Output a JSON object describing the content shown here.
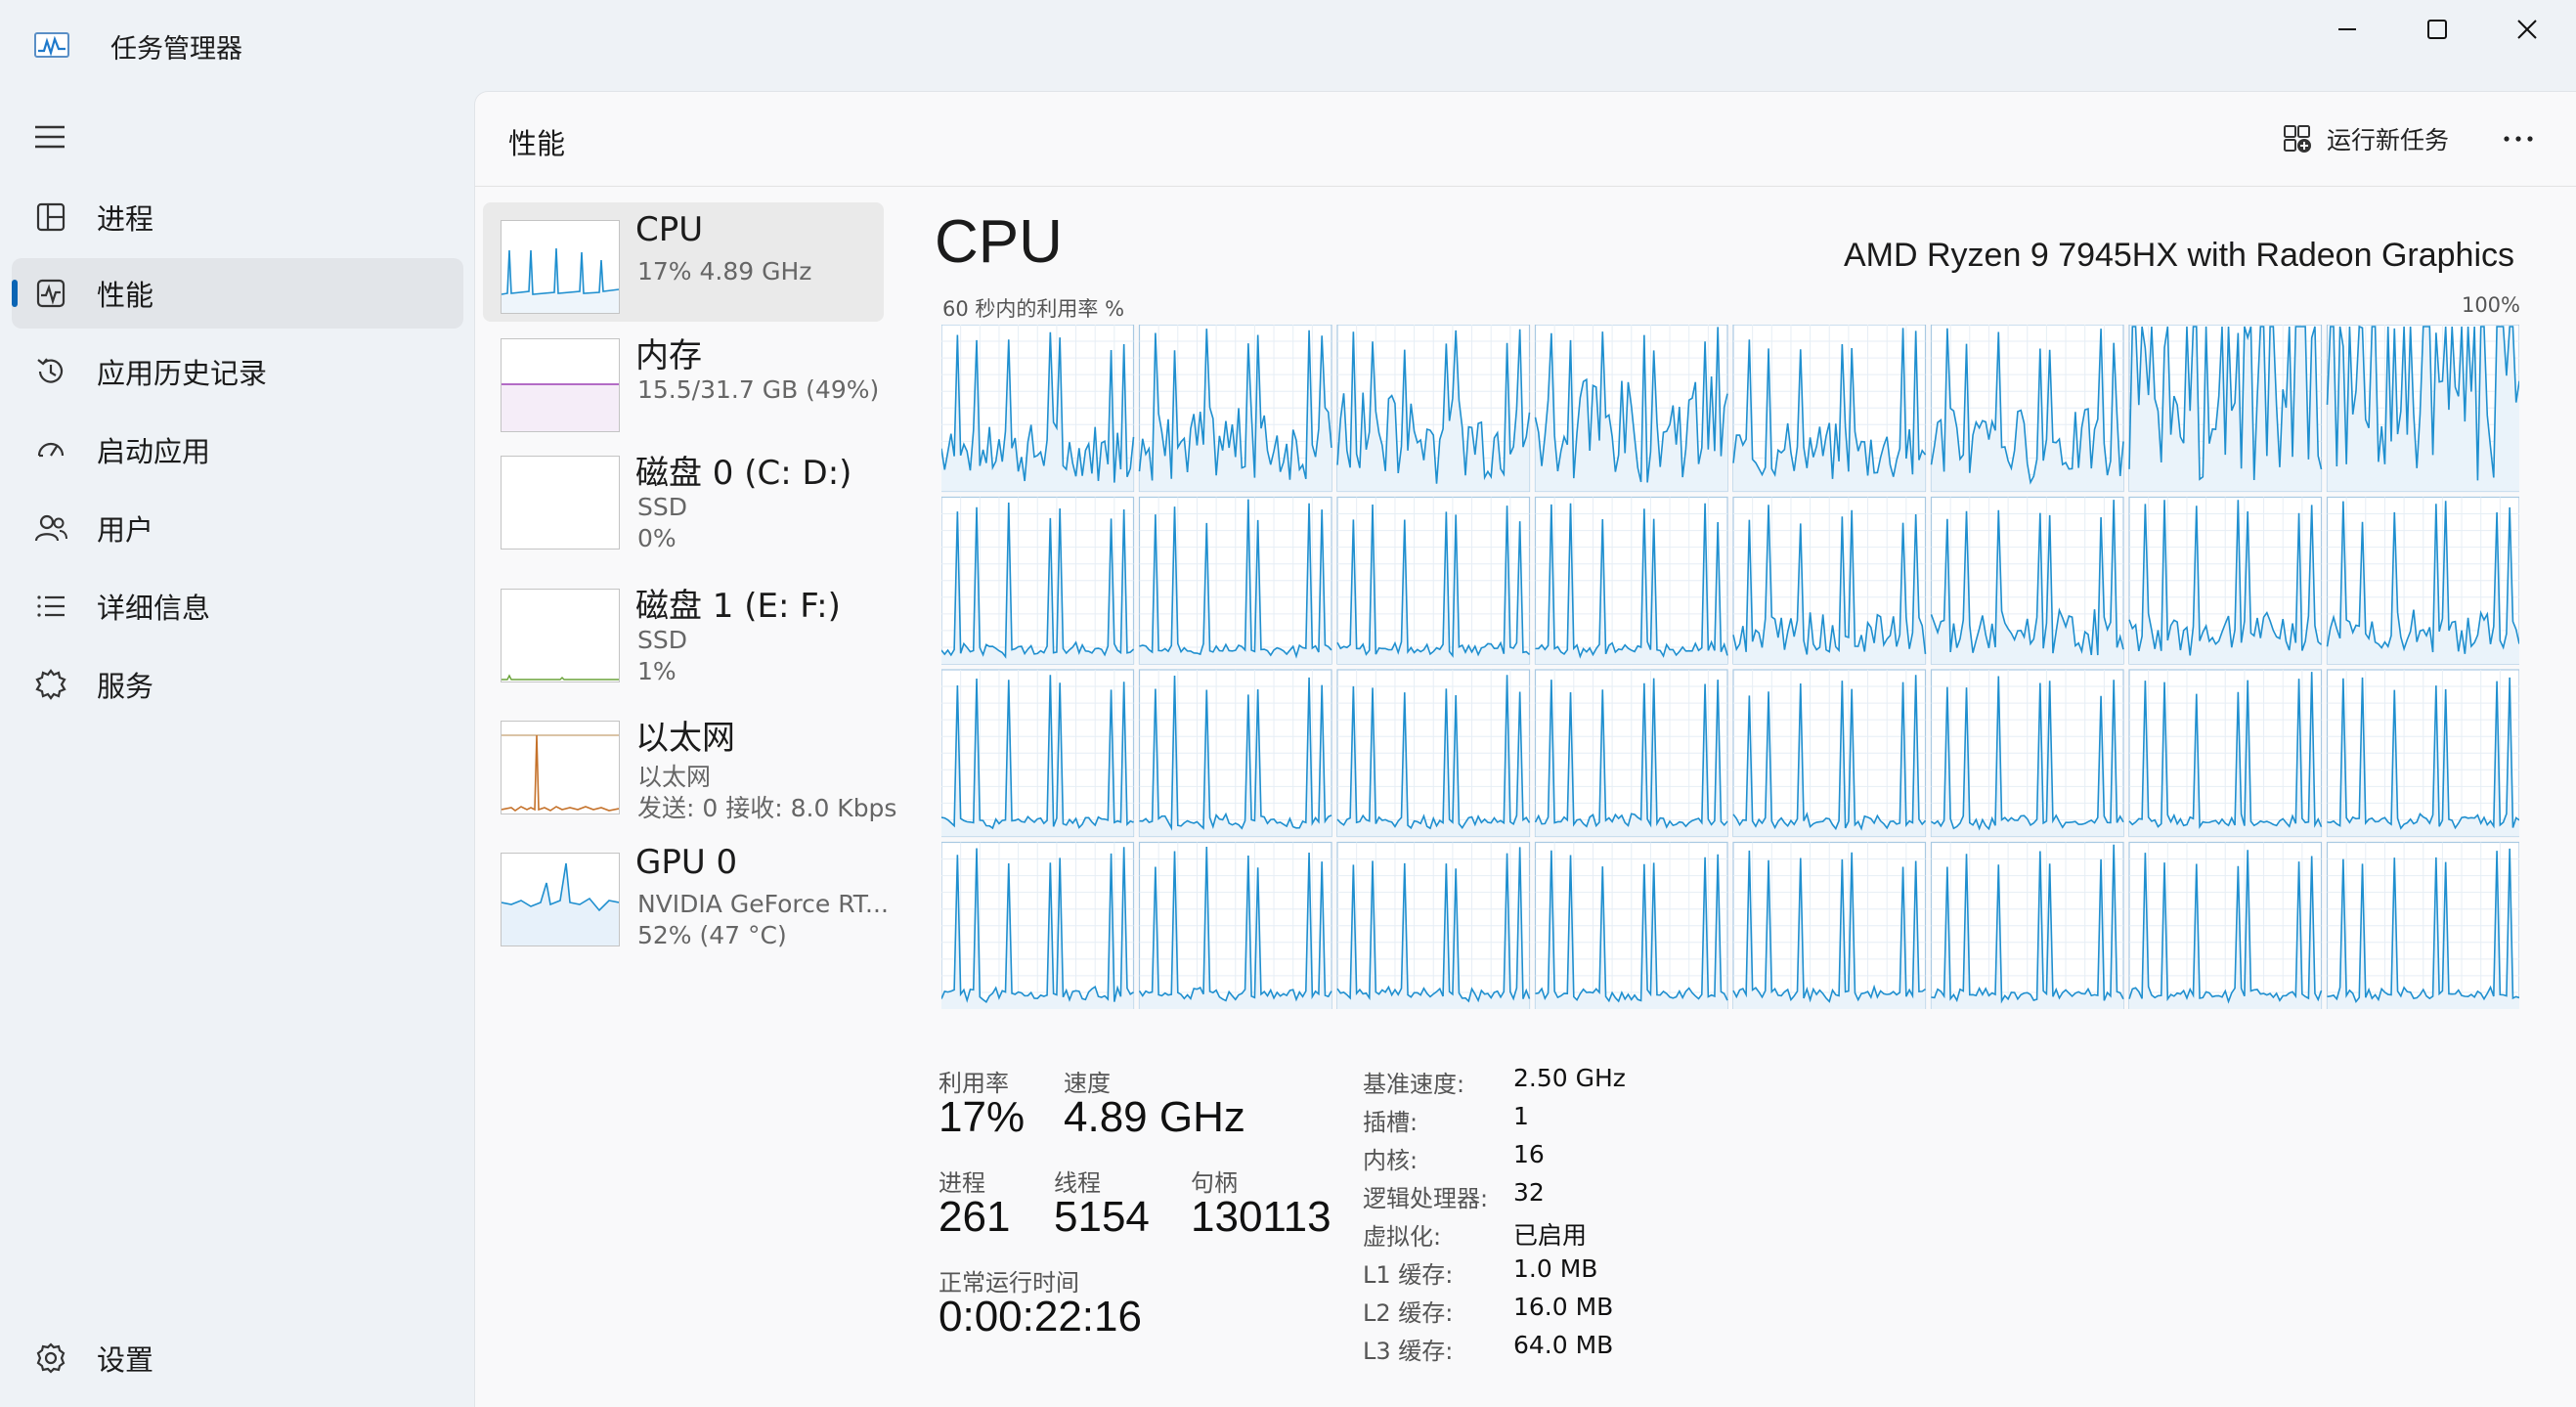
{
  "app": {
    "title": "任务管理器"
  },
  "nav": {
    "items": [
      {
        "label": "进程",
        "icon": "processes-icon"
      },
      {
        "label": "性能",
        "icon": "performance-icon"
      },
      {
        "label": "应用历史记录",
        "icon": "app-history-icon"
      },
      {
        "label": "启动应用",
        "icon": "startup-apps-icon"
      },
      {
        "label": "用户",
        "icon": "users-icon"
      },
      {
        "label": "详细信息",
        "icon": "details-icon"
      },
      {
        "label": "服务",
        "icon": "services-icon"
      }
    ],
    "settings": "设置"
  },
  "header": {
    "title": "性能",
    "run_new_task": "运行新任务"
  },
  "resources": [
    {
      "name": "CPU",
      "line1": "17%  4.89 GHz"
    },
    {
      "name": "内存",
      "line1": "15.5/31.7 GB (49%)"
    },
    {
      "name": "磁盘 0 (C: D:)",
      "line1": "SSD",
      "line2": "0%"
    },
    {
      "name": "磁盘 1 (E: F:)",
      "line1": "SSD",
      "line2": "1%"
    },
    {
      "name": "以太网",
      "line1": "以太网",
      "line2": "发送: 0 接收: 8.0 Kbps"
    },
    {
      "name": "GPU 0",
      "line1": "NVIDIA GeForce RT...",
      "line2": "52% (47 °C)"
    }
  ],
  "detail": {
    "title": "CPU",
    "model": "AMD Ryzen 9 7945HX with Radeon Graphics",
    "graph_caption": "60 秒内的利用率 %",
    "graph_max": "100%",
    "utilization_label": "利用率",
    "utilization": "17%",
    "speed_label": "速度",
    "speed": "4.89 GHz",
    "processes_label": "进程",
    "processes": "261",
    "threads_label": "线程",
    "threads": "5154",
    "handles_label": "句柄",
    "handles": "130113",
    "uptime_label": "正常运行时间",
    "uptime": "0:00:22:16",
    "specs": [
      {
        "k": "基准速度:",
        "v": "2.50 GHz"
      },
      {
        "k": "插槽:",
        "v": "1"
      },
      {
        "k": "内核:",
        "v": "16"
      },
      {
        "k": "逻辑处理器:",
        "v": "32"
      },
      {
        "k": "虚拟化:",
        "v": "已启用"
      },
      {
        "k": "L1 缓存:",
        "v": "1.0 MB"
      },
      {
        "k": "L2 缓存:",
        "v": "16.0 MB"
      },
      {
        "k": "L3 缓存:",
        "v": "64.0 MB"
      }
    ]
  },
  "colors": {
    "cpu_line": "#1f8fcf",
    "memory_line": "#9b3fb4",
    "ethernet_line": "#c5722b",
    "accent": "#0a64b4"
  }
}
